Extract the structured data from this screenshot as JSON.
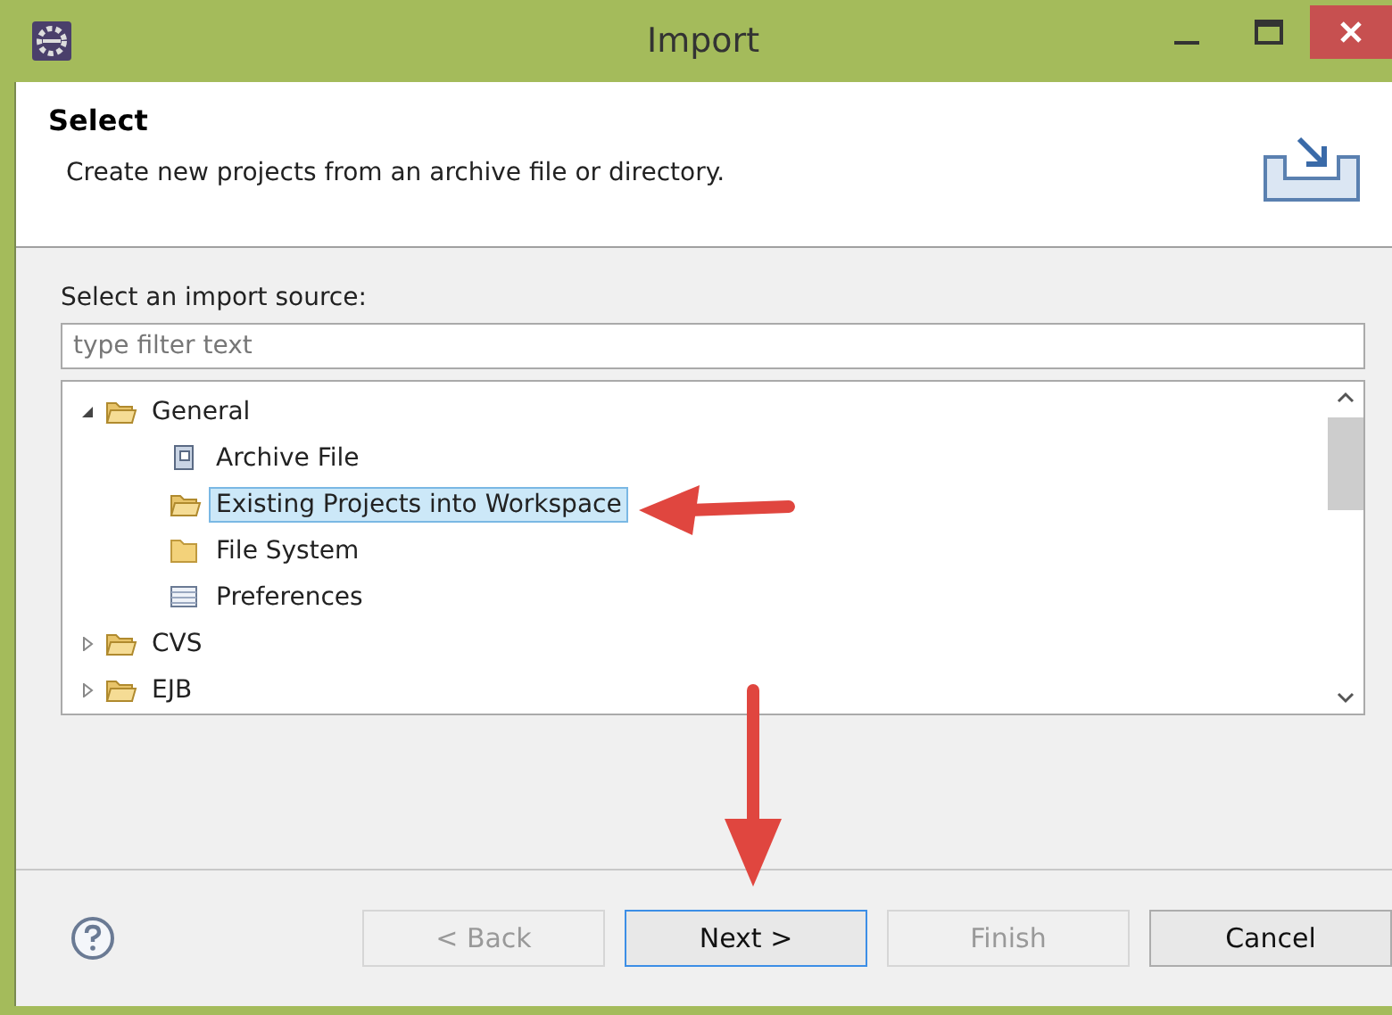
{
  "window": {
    "title": "Import"
  },
  "header": {
    "title": "Select",
    "description": "Create new projects from an archive file or directory."
  },
  "source_label": "Select an import source:",
  "filter": {
    "placeholder": "type filter text"
  },
  "tree": [
    {
      "label": "General",
      "kind": "folder",
      "expanded": true,
      "selected": false,
      "children": [
        {
          "label": "Archive File",
          "kind": "archive",
          "selected": false
        },
        {
          "label": "Existing Projects into Workspace",
          "kind": "project",
          "selected": true
        },
        {
          "label": "File System",
          "kind": "plain-folder",
          "selected": false
        },
        {
          "label": "Preferences",
          "kind": "prefs",
          "selected": false
        }
      ]
    },
    {
      "label": "CVS",
      "kind": "folder",
      "expanded": false,
      "selected": false
    },
    {
      "label": "EJB",
      "kind": "folder",
      "expanded": false,
      "selected": false
    }
  ],
  "buttons": [
    {
      "label": "< Back",
      "disabled": true,
      "default": false
    },
    {
      "label": "Next >",
      "disabled": false,
      "default": true
    },
    {
      "label": "Finish",
      "disabled": true,
      "default": false
    },
    {
      "label": "Cancel",
      "disabled": false,
      "default": false
    }
  ]
}
